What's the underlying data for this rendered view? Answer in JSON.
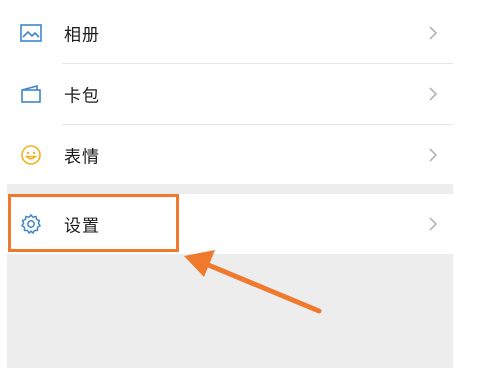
{
  "menu": {
    "items": [
      {
        "label": "相册",
        "icon": "photo-album-icon"
      },
      {
        "label": "卡包",
        "icon": "card-wallet-icon"
      },
      {
        "label": "表情",
        "icon": "smiley-icon"
      },
      {
        "label": "设置",
        "icon": "gear-icon"
      }
    ]
  },
  "colors": {
    "icon_blue": "#3f87c8",
    "icon_yellow": "#f2b323",
    "highlight_orange": "#ef7a2e",
    "background_gray": "#ededed",
    "chevron_gray": "#b5b5b5"
  }
}
